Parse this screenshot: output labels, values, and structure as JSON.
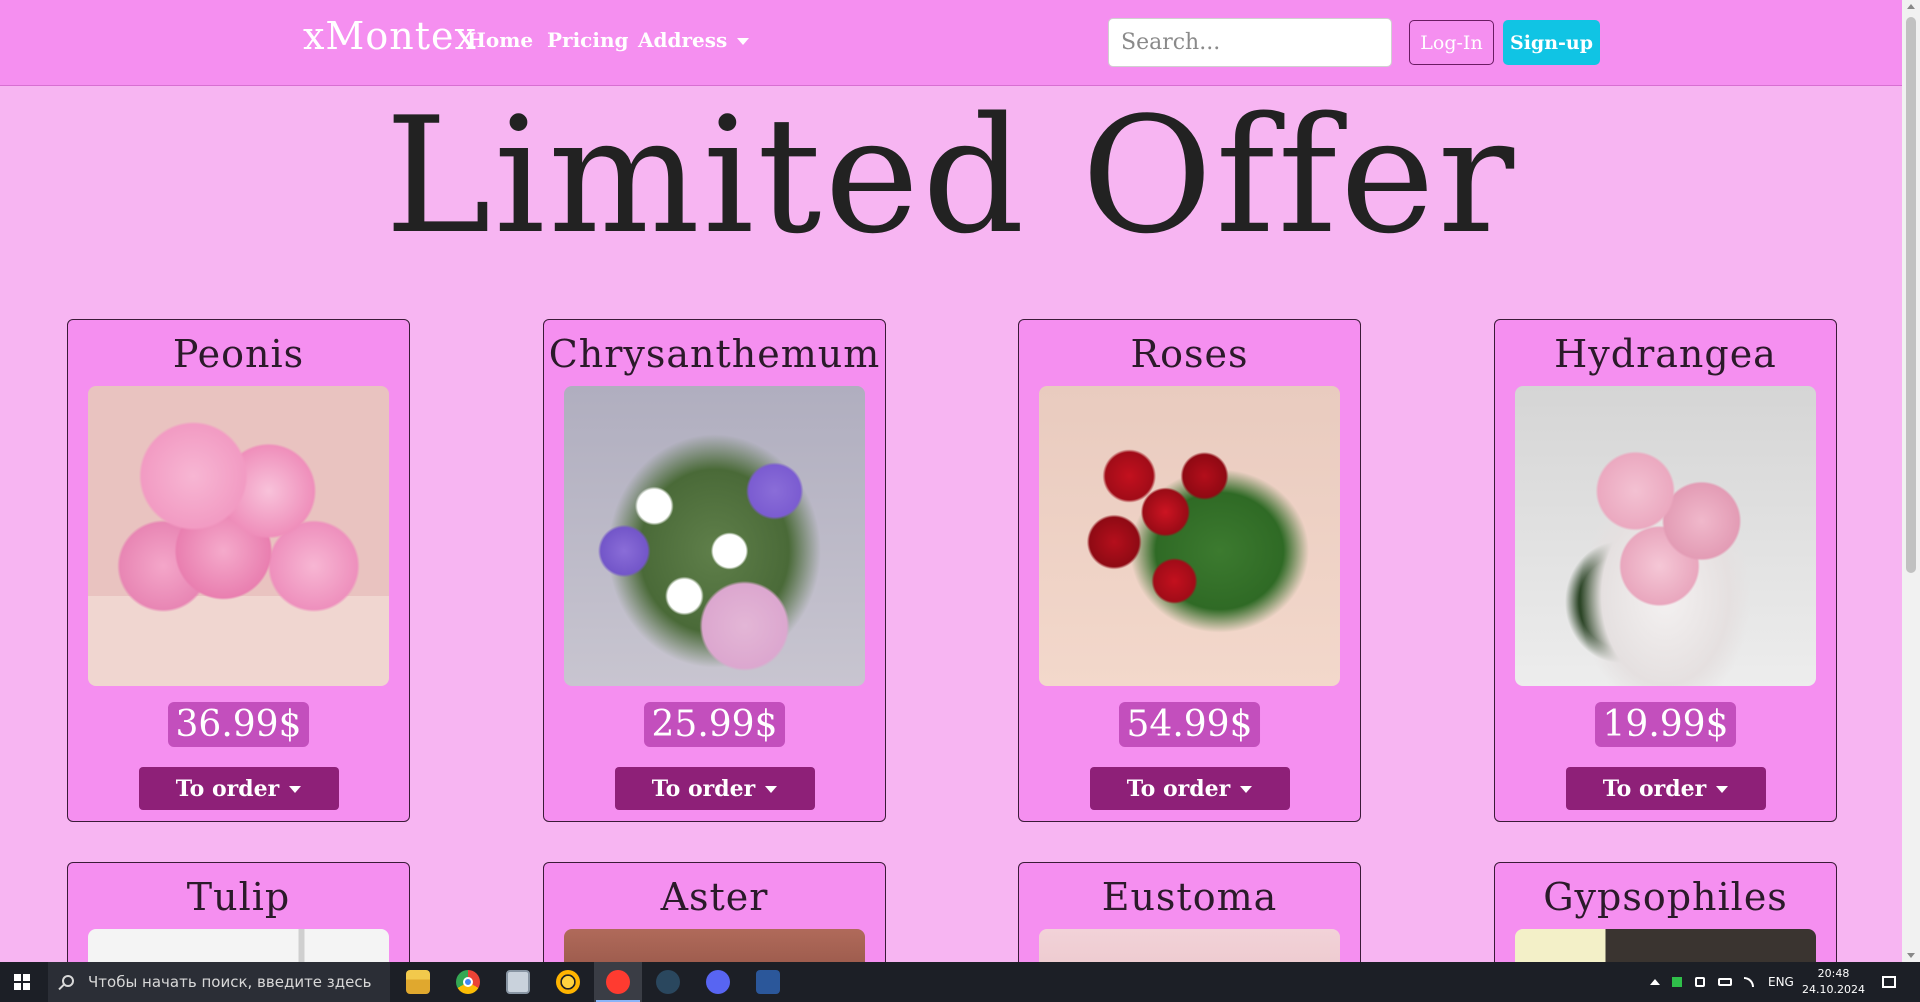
{
  "navbar": {
    "brand": "xMontex",
    "links": {
      "home": "Home",
      "pricing": "Pricing",
      "address": "Address"
    },
    "search_placeholder": "Search...",
    "login": "Log-In",
    "signup": "Sign-up"
  },
  "title": "Limited Offer",
  "products": [
    {
      "name": "Peonis",
      "price": "36.99$",
      "button": "To order"
    },
    {
      "name": "Chrysanthemum",
      "price": "25.99$",
      "button": "To order"
    },
    {
      "name": "Roses",
      "price": "54.99$",
      "button": "To order"
    },
    {
      "name": "Hydrangea",
      "price": "19.99$",
      "button": "To order"
    },
    {
      "name": "Tulip"
    },
    {
      "name": "Aster"
    },
    {
      "name": "Eustoma"
    },
    {
      "name": "Gypsophiles"
    }
  ],
  "taskbar": {
    "search_placeholder": "Чтобы начать поиск, введите здесь запрос",
    "apps": [
      "file-explorer",
      "chrome",
      "app-window",
      "sun-app",
      "yandex-browser",
      "steam",
      "discord",
      "word"
    ],
    "language": "ENG",
    "time": "20:48",
    "date": "24.10.2024"
  },
  "colors": {
    "page_bg": "#f7b5f2",
    "nav_bg": "#f58ff0",
    "price_bg": "#c34fbd",
    "order_btn": "#8e2078",
    "signup_btn": "#10c4e4"
  }
}
